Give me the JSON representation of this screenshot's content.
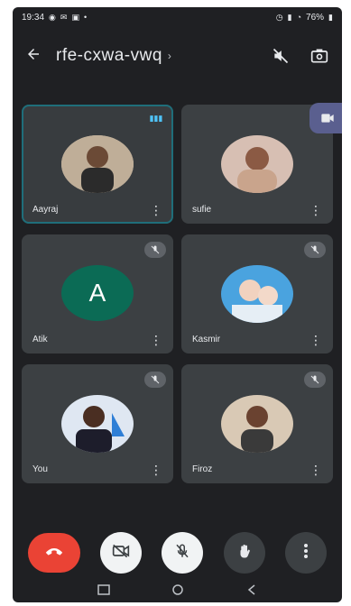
{
  "status_bar": {
    "time": "19:34",
    "battery": "76%"
  },
  "header": {
    "meeting_code": "rfe-cxwa-vwq",
    "back_icon": "arrow-left-icon",
    "audio_icon": "speaker-muted-icon",
    "camera_icon": "switch-camera-icon"
  },
  "participants": [
    {
      "name": "Aayraj",
      "state": "speaking"
    },
    {
      "name": "sufie",
      "state": "normal"
    },
    {
      "name": "Atik",
      "state": "muted",
      "initial": "A"
    },
    {
      "name": "Kasmir",
      "state": "muted"
    },
    {
      "name": "You",
      "state": "muted"
    },
    {
      "name": "Firoz",
      "state": "muted"
    }
  ],
  "controls": [
    {
      "name": "hang-up",
      "icon": "phone-hangup-icon"
    },
    {
      "name": "camera-off",
      "icon": "video-off-icon"
    },
    {
      "name": "mic-off",
      "icon": "mic-off-icon"
    },
    {
      "name": "raise-hand",
      "icon": "hand-icon"
    },
    {
      "name": "more-options",
      "icon": "more-vertical-icon"
    }
  ],
  "colors": {
    "background": "#1f2023",
    "tile": "#3c4043",
    "hangup": "#ea4335",
    "avatar_letter_bg": "#0b6b55",
    "speaking": "#4fc3f7"
  }
}
